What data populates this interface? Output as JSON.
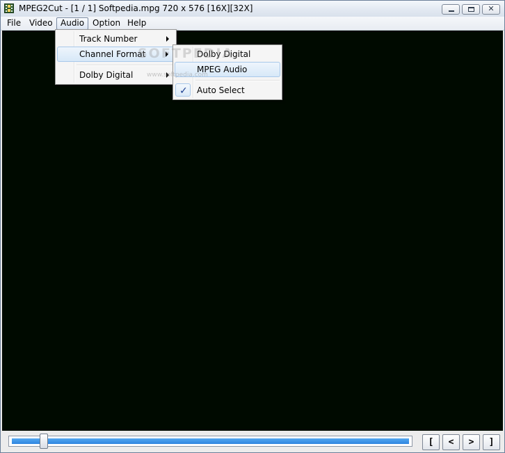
{
  "window": {
    "title": "MPEG2Cut - [1 / 1] Softpedia.mpg 720 x 576 [16X][32X]",
    "icon": "film-strip-icon",
    "controls": {
      "minimize": "minimize-icon",
      "maximize": "maximize-icon",
      "close_glyph": "✕"
    }
  },
  "menubar": {
    "items": [
      {
        "label": "File"
      },
      {
        "label": "Video"
      },
      {
        "label": "Audio",
        "active": true
      },
      {
        "label": "Option"
      },
      {
        "label": "Help"
      }
    ]
  },
  "audio_menu": {
    "items": [
      {
        "label": "Track Number",
        "submenu": true
      },
      {
        "label": "Channel Format",
        "submenu": true,
        "highlighted": true
      },
      {
        "label": "Dolby Digital",
        "submenu": true
      }
    ]
  },
  "channel_format_submenu": {
    "items": [
      {
        "label": "Dolby Digital"
      },
      {
        "label": "MPEG Audio",
        "highlighted": true
      },
      {
        "label": "Auto Select",
        "checked": true,
        "check_glyph": "✓"
      }
    ]
  },
  "watermark": {
    "text": "SOFTPEDIA",
    "url": "www.softpedia.com"
  },
  "playback": {
    "position_fraction": 0.08,
    "buttons": [
      {
        "label": "["
      },
      {
        "label": "<"
      },
      {
        "label": ">"
      },
      {
        "label": "]"
      }
    ]
  },
  "colors": {
    "video_background": "#000a00",
    "track_fill": "#2f86e0",
    "check_mark": "#1d3f8f"
  }
}
